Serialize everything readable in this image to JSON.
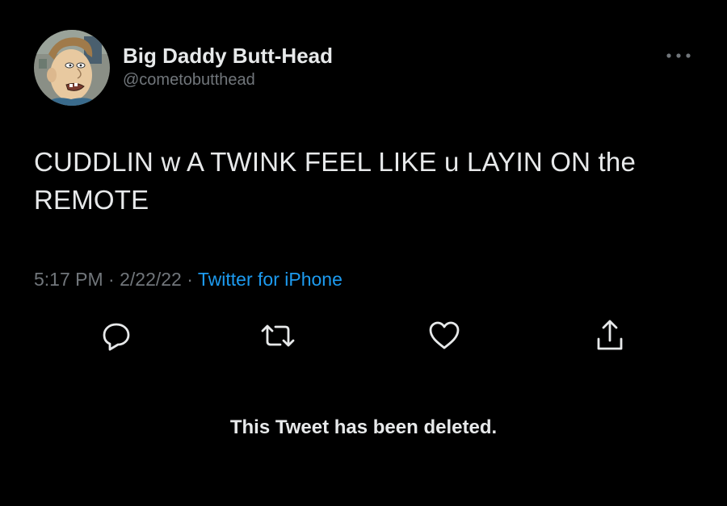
{
  "author": {
    "display_name": "Big Daddy Butt-Head",
    "handle": "@cometobutthead",
    "avatar_icon": "cartoon-avatar"
  },
  "tweet": {
    "text": "CUDDLIN w A TWINK FEEL LIKE u LAYIN ON the REMOTE",
    "time": "5:17 PM",
    "date": "2/22/22",
    "separator": "·",
    "source": "Twitter for iPhone"
  },
  "actions": {
    "reply_icon": "reply-icon",
    "retweet_icon": "retweet-icon",
    "like_icon": "heart-icon",
    "share_icon": "share-icon",
    "more_icon": "more-icon"
  },
  "notice": {
    "deleted": "This Tweet has been deleted."
  },
  "colors": {
    "background": "#000000",
    "primary_text": "#e7e9ea",
    "secondary_text": "#71767b",
    "link": "#1d9bf0"
  }
}
